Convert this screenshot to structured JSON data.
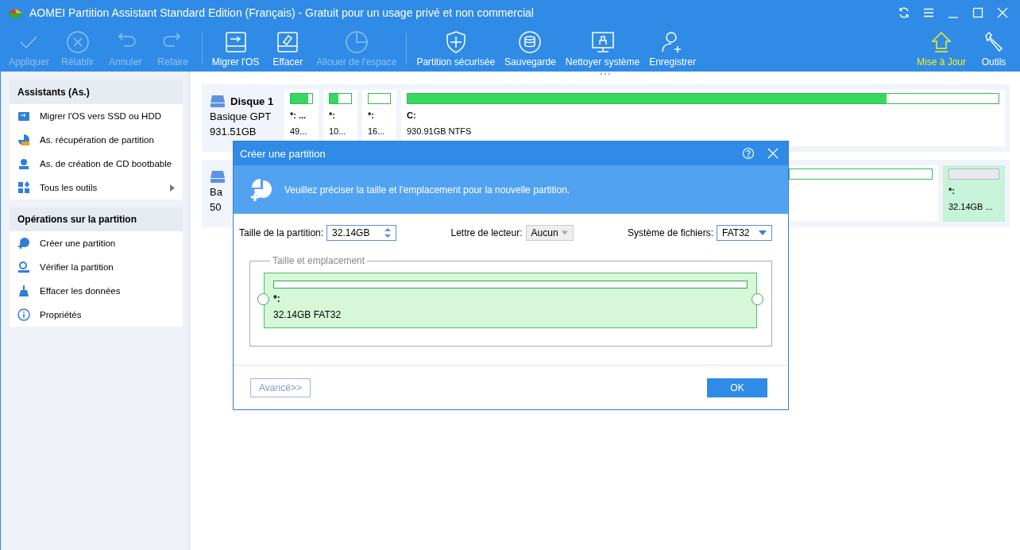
{
  "window": {
    "title": "AOMEI Partition Assistant Standard Edition (Français) - Gratuit pour un usage privé et non commercial"
  },
  "toolbar": [
    {
      "label": "Appliquer",
      "disabled": true
    },
    {
      "label": "Rétablir",
      "disabled": true
    },
    {
      "label": "Annuler",
      "disabled": true
    },
    {
      "label": "Refaire",
      "disabled": true
    },
    {
      "label": "Migrer l'OS",
      "disabled": false
    },
    {
      "label": "Effacer",
      "disabled": false
    },
    {
      "label": "Allouer de l'espace",
      "disabled": true
    },
    {
      "label": "Partition sécurisée",
      "disabled": false
    },
    {
      "label": "Sauvegarde",
      "disabled": false
    },
    {
      "label": "Nettoyer système",
      "disabled": false
    },
    {
      "label": "Enregistrer",
      "disabled": false
    }
  ],
  "toolbar_right": [
    {
      "label": "Mise à Jour",
      "highlighted": true
    },
    {
      "label": "Outils",
      "highlighted": false
    }
  ],
  "sidebar": {
    "sections": [
      {
        "title": "Assistants (As.)",
        "items": [
          {
            "label": "Migrer l'OS vers SSD ou HDD",
            "submenu": false
          },
          {
            "label": "As. récupération de partition",
            "submenu": false
          },
          {
            "label": "As. de création de CD bootbable",
            "submenu": false
          },
          {
            "label": "Tous les outils",
            "submenu": true
          }
        ]
      },
      {
        "title": "Opérations sur la partition",
        "items": [
          {
            "label": "Créer une partition",
            "submenu": false
          },
          {
            "label": "Vérifier la partition",
            "submenu": false
          },
          {
            "label": "Effacer les données",
            "submenu": false
          },
          {
            "label": "Propriétés",
            "submenu": false
          }
        ]
      }
    ]
  },
  "disks": [
    {
      "name": "Disque 1",
      "type": "Basique GPT",
      "size": "931.51GB",
      "partitions": [
        {
          "letter": "*: ...",
          "info": "49...",
          "level": 0.8,
          "selected": false,
          "kind": "small"
        },
        {
          "letter": "*:",
          "info": "10...",
          "level": 0.4,
          "selected": false,
          "kind": "small"
        },
        {
          "letter": "*:",
          "info": "16...",
          "selected": false,
          "kind": "small"
        },
        {
          "letter": "C:",
          "info": "930.91GB NTFS",
          "level": 0.81,
          "selected": false,
          "kind": "wide"
        }
      ]
    },
    {
      "type": "Ba",
      "size": "50",
      "partitions": [
        {
          "selected": false,
          "kind": "wide"
        },
        {
          "letter": "*:",
          "info": "32.14GB ...",
          "selected": true,
          "kind": "unallocated"
        }
      ]
    }
  ],
  "dialog": {
    "title": "Créer une partition",
    "message": "Veuillez préciser la taille et l'emplacement pour la nouvelle partition.",
    "size_label": "Taille de la partition:",
    "size_value": "32.14GB",
    "letter_label": "Lettre de lecteur:",
    "letter_value": "Aucun",
    "letter_disabled": true,
    "fs_label": "Système de fichiers:",
    "fs_value": "FAT32",
    "group_title": "Taille et emplacement",
    "partition_letter": "*:",
    "partition_info": "32.14GB FAT32",
    "advanced_button": "Avancé>>",
    "ok_button": "OK"
  }
}
